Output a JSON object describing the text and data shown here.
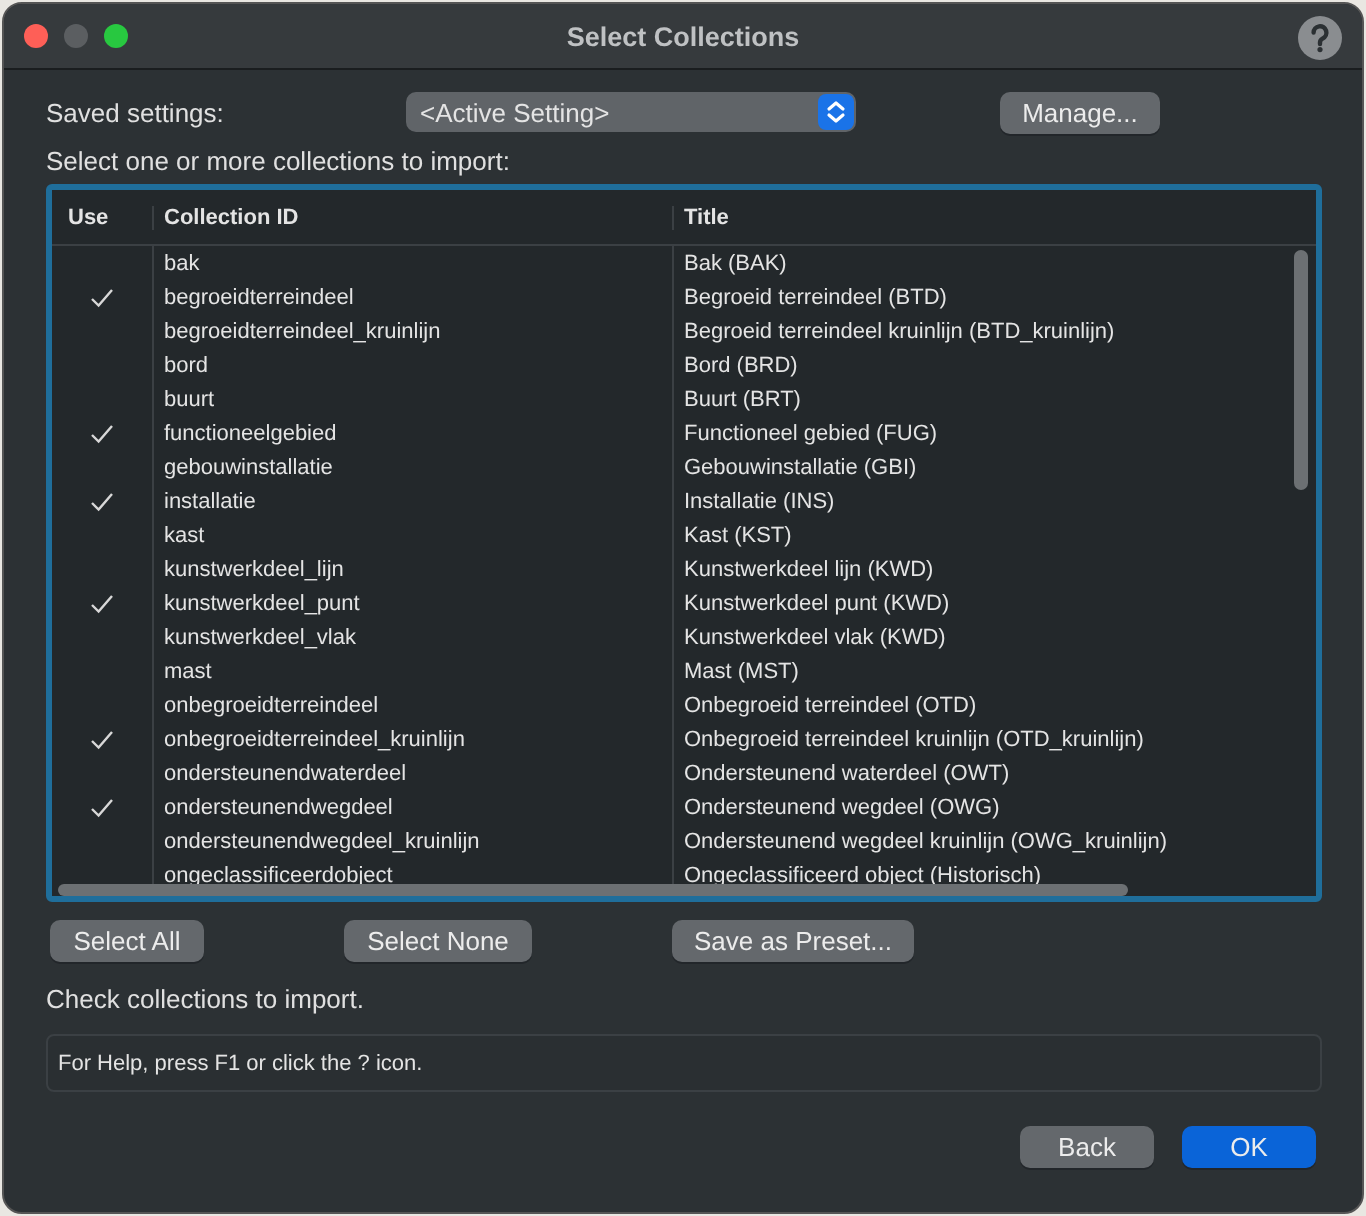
{
  "window": {
    "title": "Select Collections"
  },
  "saved_settings": {
    "label": "Saved settings:",
    "value": "<Active Setting>",
    "manage_button": "Manage..."
  },
  "instruction": "Select one or more collections to import:",
  "table": {
    "columns": [
      "Use",
      "Collection ID",
      "Title"
    ],
    "rows": [
      {
        "checked": false,
        "id": "bak",
        "title": "Bak (BAK)"
      },
      {
        "checked": true,
        "id": "begroeidterreindeel",
        "title": "Begroeid terreindeel (BTD)"
      },
      {
        "checked": false,
        "id": "begroeidterreindeel_kruinlijn",
        "title": "Begroeid terreindeel kruinlijn (BTD_kruinlijn)"
      },
      {
        "checked": false,
        "id": "bord",
        "title": "Bord (BRD)"
      },
      {
        "checked": false,
        "id": "buurt",
        "title": "Buurt (BRT)"
      },
      {
        "checked": true,
        "id": "functioneelgebied",
        "title": "Functioneel gebied (FUG)"
      },
      {
        "checked": false,
        "id": "gebouwinstallatie",
        "title": "Gebouwinstallatie (GBI)"
      },
      {
        "checked": true,
        "id": "installatie",
        "title": "Installatie (INS)"
      },
      {
        "checked": false,
        "id": "kast",
        "title": "Kast (KST)"
      },
      {
        "checked": false,
        "id": "kunstwerkdeel_lijn",
        "title": "Kunstwerkdeel lijn (KWD)"
      },
      {
        "checked": true,
        "id": "kunstwerkdeel_punt",
        "title": "Kunstwerkdeel punt (KWD)"
      },
      {
        "checked": false,
        "id": "kunstwerkdeel_vlak",
        "title": "Kunstwerkdeel vlak (KWD)"
      },
      {
        "checked": false,
        "id": "mast",
        "title": "Mast (MST)"
      },
      {
        "checked": false,
        "id": "onbegroeidterreindeel",
        "title": "Onbegroeid terreindeel (OTD)"
      },
      {
        "checked": true,
        "id": "onbegroeidterreindeel_kruinlijn",
        "title": "Onbegroeid terreindeel kruinlijn (OTD_kruinlijn)"
      },
      {
        "checked": false,
        "id": "ondersteunendwaterdeel",
        "title": "Ondersteunend waterdeel (OWT)"
      },
      {
        "checked": true,
        "id": "ondersteunendwegdeel",
        "title": "Ondersteunend wegdeel (OWG)"
      },
      {
        "checked": false,
        "id": "ondersteunendwegdeel_kruinlijn",
        "title": "Ondersteunend wegdeel kruinlijn (OWG_kruinlijn)"
      },
      {
        "checked": false,
        "id": "ongeclassificeerdobject",
        "title": "Ongeclassificeerd object (Historisch)"
      }
    ]
  },
  "table_buttons": [
    "Select All",
    "Select None",
    "Save as Preset..."
  ],
  "status": "Check collections to import.",
  "help_text": "For Help, press F1 or click the ? icon.",
  "footer_buttons": [
    {
      "label": "Back",
      "kind": "normal"
    },
    {
      "label": "OK",
      "kind": "default"
    }
  ]
}
